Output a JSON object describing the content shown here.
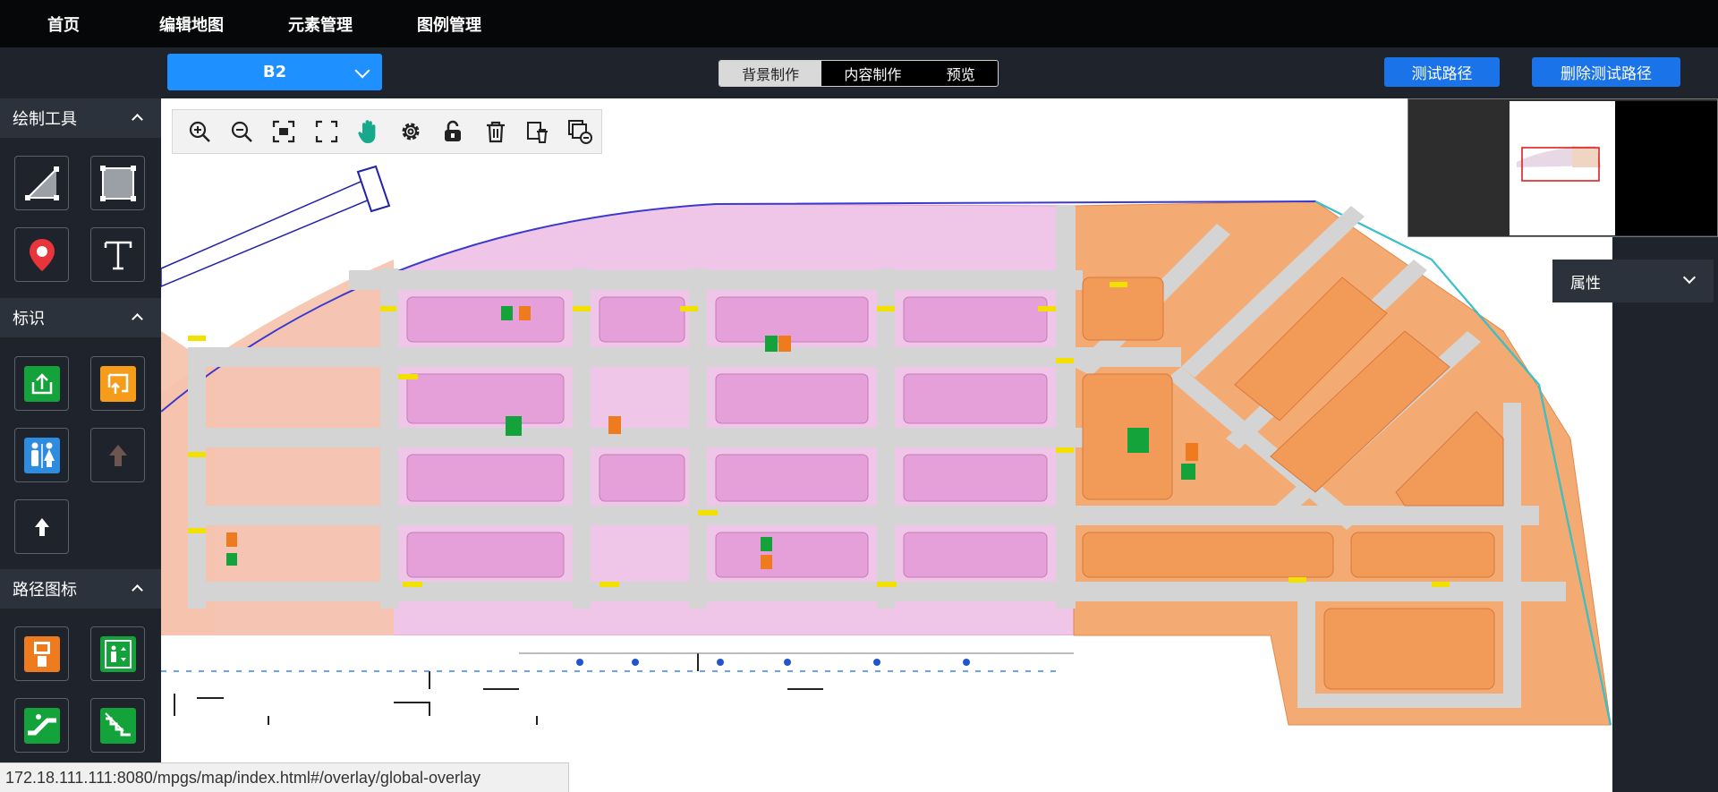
{
  "topnav": {
    "items": [
      {
        "label": "首页"
      },
      {
        "label": "编辑地图"
      },
      {
        "label": "元素管理"
      },
      {
        "label": "图例管理"
      }
    ]
  },
  "floor": {
    "selected": "B2"
  },
  "modes": {
    "tabs": [
      {
        "label": "背景制作",
        "active": true
      },
      {
        "label": "内容制作",
        "active": false
      },
      {
        "label": "预览",
        "active": false
      }
    ]
  },
  "actions": {
    "test_path": "测试路径",
    "delete_test_path": "删除测试路径"
  },
  "sidebar": {
    "drawing_tools": {
      "title": "绘制工具"
    },
    "markers": {
      "title": "标识"
    },
    "path_icons": {
      "title": "路径图标"
    }
  },
  "properties": {
    "title": "属性"
  },
  "status": {
    "url": "172.18.111.111:8080/mpgs/map/index.html#/overlay/global-overlay"
  },
  "colors": {
    "accent": "#1e90ff",
    "button_blue": "#1a73e8",
    "green_icon": "#14a33a",
    "orange_icon": "#f59c1a",
    "blue_icon": "#2d8ce0",
    "zone_pink": "#e9a6df",
    "zone_orange": "#f4a363"
  },
  "icons": {
    "drawing_tools": [
      "line-tool-icon",
      "rectangle-tool-icon",
      "map-pin-icon",
      "text-tool-icon"
    ],
    "markers": [
      "exit-sign-icon",
      "emergency-exit-icon",
      "restroom-icon",
      "arrow-up-dark-icon",
      "arrow-up-icon"
    ],
    "path_icons": [
      "elevator-icon",
      "lift-icon",
      "escalator-icon",
      "stairs-icon"
    ],
    "map_toolbar": [
      "zoom-in-icon",
      "zoom-out-icon",
      "fit-view-icon",
      "fullscreen-icon",
      "pan-hand-icon",
      "settings-icon",
      "unlock-icon",
      "delete-icon",
      "delete-layer-icon",
      "remove-layer-icon"
    ]
  }
}
